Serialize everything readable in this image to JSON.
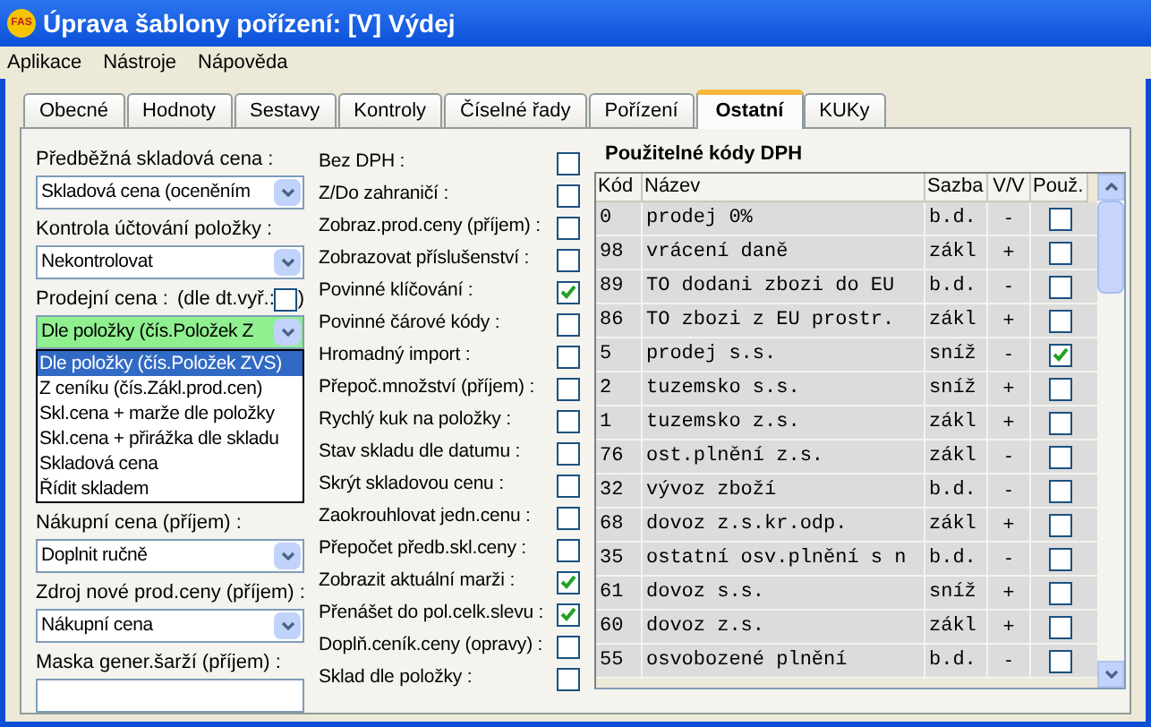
{
  "window": {
    "logo": "FAS",
    "title": "Úprava šablony pořízení: [V] Výdej"
  },
  "menu": [
    "Aplikace",
    "Nástroje",
    "Nápověda"
  ],
  "tabs": [
    {
      "label": "Obecné",
      "selected": false
    },
    {
      "label": "Hodnoty",
      "selected": false
    },
    {
      "label": "Sestavy",
      "selected": false
    },
    {
      "label": "Kontroly",
      "selected": false
    },
    {
      "label": "Číselné řady",
      "selected": false
    },
    {
      "label": "Pořízení",
      "selected": false
    },
    {
      "label": "Ostatní",
      "selected": true
    },
    {
      "label": "KUKy",
      "selected": false
    }
  ],
  "fields": [
    {
      "kind": "combo",
      "label": "Předběžná skladová cena :",
      "value": "Skladová cena (oceněním",
      "highlighted": false
    },
    {
      "kind": "combo",
      "label": "Kontrola účtování položky :",
      "value": "Nekontrolovat",
      "highlighted": false
    },
    {
      "kind": "combo",
      "label": "Prodejní cena :",
      "extra_label": "(dle dt.vyř.:",
      "extra_checked": false,
      "extra_close": ")",
      "value": "Dle položky (čís.Položek Z",
      "highlighted": true,
      "expanded": true,
      "options": [
        {
          "label": "Dle položky (čís.Položek ZVS)",
          "selected": true
        },
        {
          "label": "Z ceníku (čís.Zákl.prod.cen)",
          "selected": false
        },
        {
          "label": "Skl.cena + marže dle položky",
          "selected": false
        },
        {
          "label": "Skl.cena + přirážka dle skladu",
          "selected": false
        },
        {
          "label": "Skladová cena",
          "selected": false
        },
        {
          "label": "Řídit skladem",
          "selected": false
        }
      ]
    },
    {
      "kind": "combo",
      "label": "Nákupní cena (příjem) :",
      "value": "Doplnit ručně",
      "highlighted": false
    },
    {
      "kind": "combo",
      "label": "Zdroj nové prod.ceny (příjem) :",
      "value": "Nákupní cena",
      "highlighted": false
    },
    {
      "kind": "input",
      "label": "Maska gener.šarží (příjem) :"
    }
  ],
  "options": [
    {
      "label": "Bez DPH :",
      "checked": false
    },
    {
      "label": "Z/Do zahraničí :",
      "checked": false
    },
    {
      "label": "Zobraz.prod.ceny (příjem) :",
      "checked": false
    },
    {
      "label": "Zobrazovat příslušenství :",
      "checked": false
    },
    {
      "label": "Povinné klíčování :",
      "checked": true
    },
    {
      "label": "Povinné čárové kódy :",
      "checked": false
    },
    {
      "label": "Hromadný import :",
      "checked": false
    },
    {
      "label": "Přepoč.množství (příjem) :",
      "checked": false
    },
    {
      "label": "Rychlý kuk na položky :",
      "checked": false
    },
    {
      "label": "Stav skladu dle datumu :",
      "checked": false
    },
    {
      "label": "Skrýt skladovou cenu :",
      "checked": false
    },
    {
      "label": "Zaokrouhlovat jedn.cenu :",
      "checked": false
    },
    {
      "label": "Přepočet předb.skl.ceny :",
      "checked": false
    },
    {
      "label": "Zobrazit aktuální marži :",
      "checked": true
    },
    {
      "label": "Přenášet do pol.celk.slevu :",
      "checked": true
    },
    {
      "label": "Doplň.ceník.ceny (opravy) :",
      "checked": false
    },
    {
      "label": "Sklad dle položky :",
      "checked": false
    }
  ],
  "vat": {
    "title": "Použitelné kódy DPH",
    "columns": [
      "Kód",
      "Název",
      "Sazba",
      "V/V",
      "Použ."
    ],
    "rows": [
      {
        "code": "0",
        "name": "prodej  0%",
        "rate": "b.d.",
        "sign": "-",
        "used": false
      },
      {
        "code": "98",
        "name": "vrácení daně",
        "rate": "zákl",
        "sign": "+",
        "used": false
      },
      {
        "code": "89",
        "name": "TO dodani zbozi do EU",
        "rate": "b.d.",
        "sign": "-",
        "used": false
      },
      {
        "code": "86",
        "name": "TO zbozi z  EU prostr.",
        "rate": "zákl",
        "sign": "+",
        "used": false
      },
      {
        "code": "5",
        "name": "prodej  s.s.",
        "rate": "sníž",
        "sign": "-",
        "used": true
      },
      {
        "code": "2",
        "name": "tuzemsko s.s.",
        "rate": "sníž",
        "sign": "+",
        "used": false
      },
      {
        "code": "1",
        "name": "tuzemsko z.s.",
        "rate": "zákl",
        "sign": "+",
        "used": false
      },
      {
        "code": "76",
        "name": "ost.plnění z.s.",
        "rate": "zákl",
        "sign": "-",
        "used": false
      },
      {
        "code": "32",
        "name": "vývoz zboží",
        "rate": "b.d.",
        "sign": "-",
        "used": false
      },
      {
        "code": "68",
        "name": "dovoz z.s.kr.odp.",
        "rate": "zákl",
        "sign": "+",
        "used": false
      },
      {
        "code": "35",
        "name": "ostatní osv.plnění s n",
        "rate": "b.d.",
        "sign": "-",
        "used": false
      },
      {
        "code": "61",
        "name": "dovoz s.s.",
        "rate": "sníž",
        "sign": "+",
        "used": false
      },
      {
        "code": "60",
        "name": "dovoz z.s.",
        "rate": "zákl",
        "sign": "+",
        "used": false
      },
      {
        "code": "55",
        "name": "osvobozené plnění",
        "rate": "b.d.",
        "sign": "-",
        "used": false
      }
    ]
  }
}
